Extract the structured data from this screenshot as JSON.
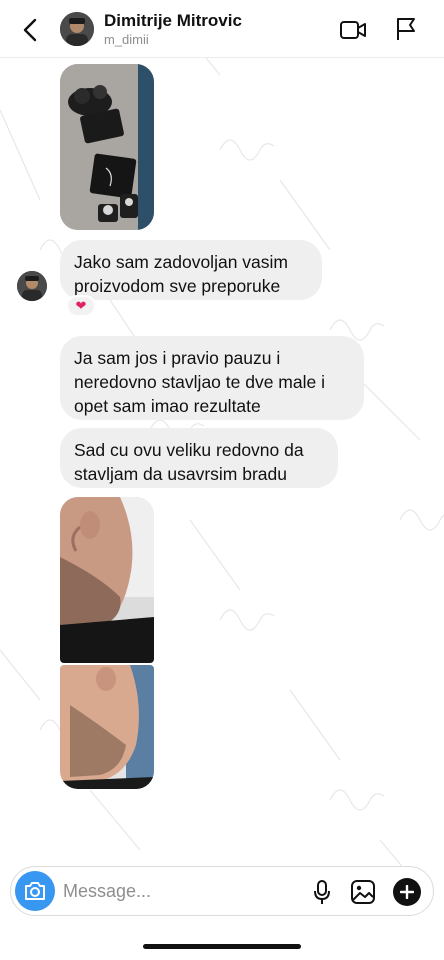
{
  "header": {
    "display_name": "Dimitrije Mitrovic",
    "username": "m_dimii",
    "back_icon": "chevron-left-icon",
    "video_icon": "video-camera-icon",
    "flag_icon": "flag-icon"
  },
  "thread": {
    "messages": [
      {
        "type": "photo",
        "alt": "product-photo"
      },
      {
        "type": "text",
        "text": "Jako sam zadovoljan vasim\nproizvodom sve preporuke",
        "reaction": "❤"
      },
      {
        "type": "text",
        "text": "Ja sam jos i pravio pauzu i\nneredovno stavljao te dve male i\nopet sam imao rezultate"
      },
      {
        "type": "text",
        "text": "Sad cu ovu veliku redovno da\nstavljam da usavrsim bradu"
      },
      {
        "type": "photo",
        "alt": "beard-photo-1"
      },
      {
        "type": "photo",
        "alt": "beard-photo-2"
      }
    ]
  },
  "composer": {
    "placeholder": "Message...",
    "camera_icon": "camera-icon",
    "mic_icon": "microphone-icon",
    "gallery_icon": "image-icon",
    "plus_icon": "plus-icon"
  },
  "colors": {
    "accent": "#3897f0",
    "bubble": "#efefef",
    "heart": "#e0245e"
  }
}
